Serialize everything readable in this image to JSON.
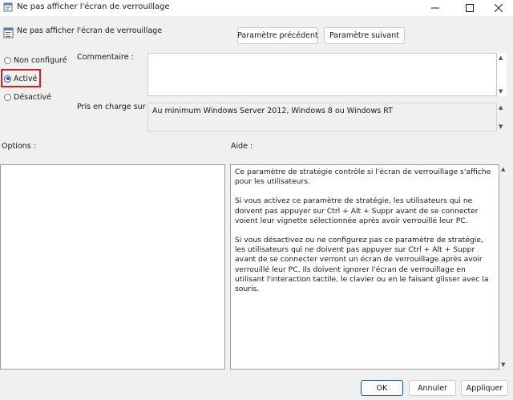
{
  "window": {
    "title": "Ne pas afficher l'écran de verrouillage",
    "icon": "policy-icon",
    "controls": [
      "minimize-icon",
      "maximize-icon",
      "close-icon"
    ]
  },
  "header": {
    "setting_name": "Ne pas afficher l'écran de verrouillage",
    "prev_button": "Paramètre précédent",
    "next_button": "Paramètre suivant"
  },
  "state": {
    "options": [
      {
        "label": "Non configuré",
        "checked": false
      },
      {
        "label": "Activé",
        "checked": true
      },
      {
        "label": "Désactivé",
        "checked": false
      }
    ],
    "highlight_color": "#d11f1f"
  },
  "comment": {
    "label": "Commentaire :",
    "value": ""
  },
  "supported": {
    "label": "Pris en charge sur :",
    "value": "Au minimum Windows Server 2012, Windows 8 ou Windows RT"
  },
  "panels": {
    "options_label": "Options :",
    "help_label": "Aide :",
    "help_paragraphs": [
      "Ce paramètre de stratégie contrôle si l'écran de verrouillage s'affiche pour les utilisateurs.",
      "Si vous activez ce paramètre de stratégie, les utilisateurs qui ne doivent pas appuyer sur Ctrl + Alt + Suppr avant de se connecter voient leur vignette sélectionnée après avoir verrouillé leur PC.",
      "Si vous désactivez ou ne configurez pas ce paramètre de stratégie, les utilisateurs qui ne doivent pas appuyer sur Ctrl + Alt + Suppr avant de se connecter verront un écran de verrouillage après avoir verrouillé leur PC. Ils doivent ignorer l'écran de verrouillage en utilisant l'interaction tactile, le clavier ou en le faisant glisser avec la souris."
    ]
  },
  "footer": {
    "ok": "OK",
    "cancel": "Annuler",
    "apply": "Appliquer"
  }
}
